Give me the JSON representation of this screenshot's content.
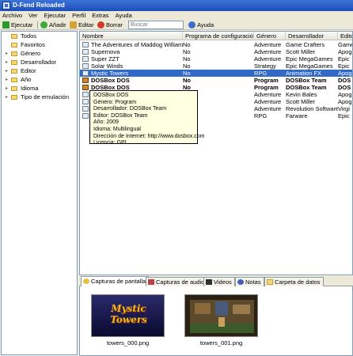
{
  "window": {
    "title": "D-Fend Reloaded"
  },
  "menu": [
    "Archivo",
    "Ver",
    "Ejecutar",
    "Perfil",
    "Extras",
    "Ayuda"
  ],
  "toolbar": {
    "run": "Ejecutar",
    "add": "Añadir",
    "edit": "Editar",
    "delete": "Borrar",
    "search_placeholder": "Buscar",
    "help": "Ayuda"
  },
  "tree": {
    "items": [
      "Todos",
      "Favoritos",
      "Género",
      "Desarrollador",
      "Editor",
      "Año",
      "Idioma",
      "Tipo de emulación"
    ]
  },
  "table": {
    "columns": [
      "Nombre",
      "Programa de configuración",
      "Género",
      "Desarrollador",
      "Edito"
    ],
    "rows": [
      {
        "name": "The Adventures of Maddog Williams",
        "setup": "No",
        "genre": "Adventure",
        "developer": "Game Crafters",
        "editor": "Game"
      },
      {
        "name": "Supernova",
        "setup": "No",
        "genre": "Adventure",
        "developer": "Scott Miller",
        "editor": "Apog"
      },
      {
        "name": "Super ZZT",
        "setup": "No",
        "genre": "Adventure",
        "developer": "Epic MegaGames",
        "editor": "Epic"
      },
      {
        "name": "Solar Winds",
        "setup": "No",
        "genre": "Strategy",
        "developer": "Epic MegaGames",
        "editor": "Epic"
      },
      {
        "name": "Mystic Towers",
        "setup": "No",
        "genre": "RPG",
        "developer": "Animation FX",
        "editor": "Apog"
      },
      {
        "name": "DOSBox DOS",
        "setup": "No",
        "genre": "Program",
        "developer": "DOSBox Team",
        "editor": "DOS"
      },
      {
        "name": "DOSBox DOS",
        "setup": "No",
        "genre": "Program",
        "developer": "DOSBox Team",
        "editor": "DOS"
      },
      {
        "name": "C:",
        "setup": "",
        "genre": "Adventure",
        "developer": "Kevin Bales",
        "editor": "Apog"
      },
      {
        "name": "Bi",
        "setup": "",
        "genre": "Adventure",
        "developer": "Scott Miller",
        "editor": "Apog"
      },
      {
        "name": "Bi",
        "setup": "",
        "genre": "Adventure",
        "developer": "Revolution Software",
        "editor": "Virgi"
      },
      {
        "name": "Ci",
        "setup": "",
        "genre": "RPG",
        "developer": "Farware",
        "editor": "Epic"
      }
    ]
  },
  "tooltip": {
    "title": "DOSBox DOS",
    "lines": [
      "Género: Program",
      "Desarrollador: DOSBox Team",
      "Editor: DOSBox Team",
      "Año: 2009",
      "Idioma: Multilingual",
      "Dirección de Internet: http://www.dosbox.com",
      "Licencia: GPL"
    ]
  },
  "tabs": [
    "Capturas de pantalla",
    "Capturas de audio",
    "Videos",
    "Notas",
    "Carpeta de datos"
  ],
  "screenshots": [
    {
      "file": "towers_000.png",
      "logo": "Mystic Towers"
    },
    {
      "file": "towers_001.png"
    }
  ]
}
